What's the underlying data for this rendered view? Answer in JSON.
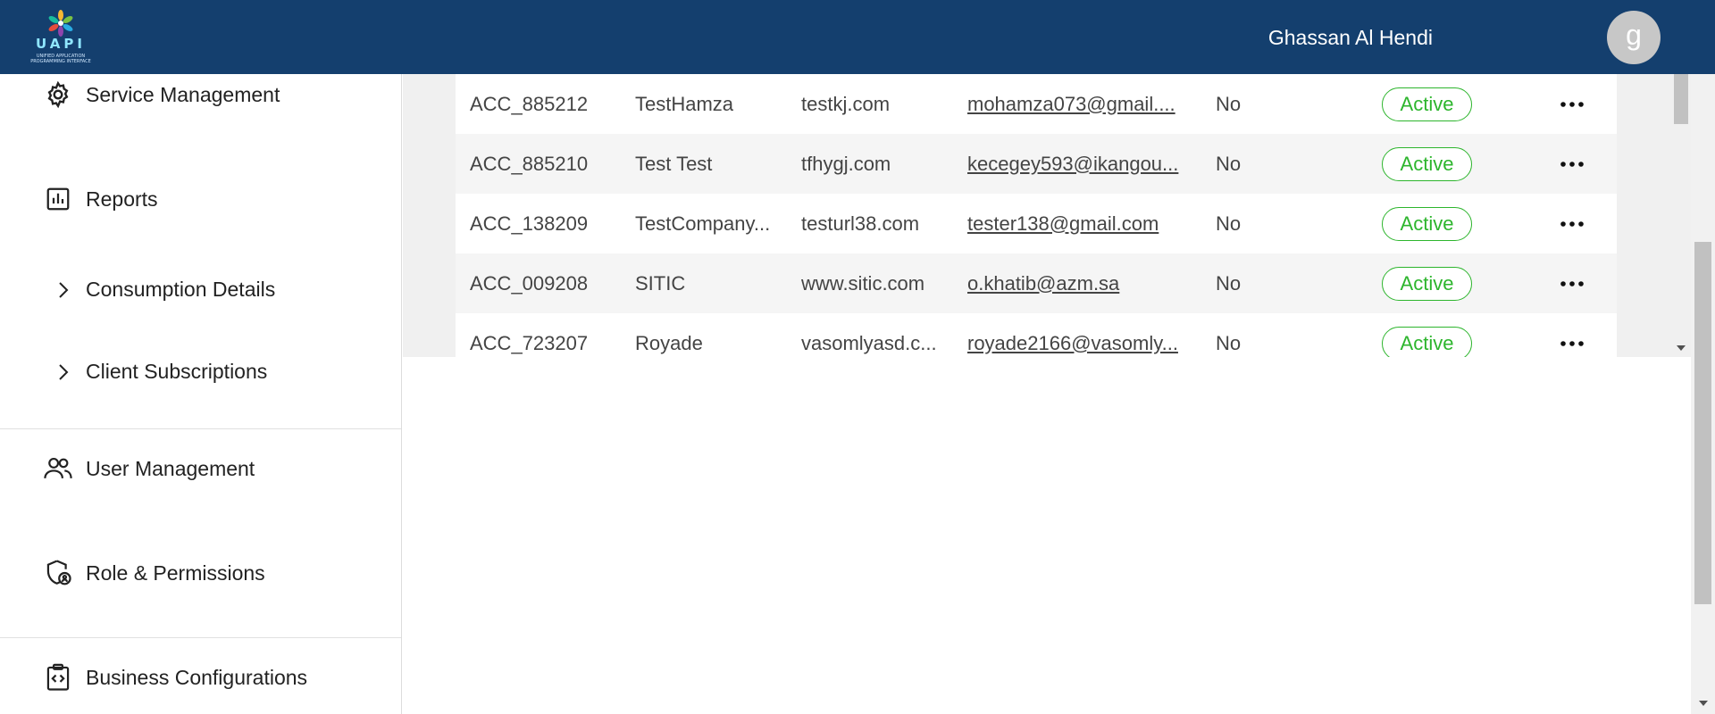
{
  "header": {
    "logo_text": "UAPI",
    "logo_subtitle": "UNIFIED APPLICATION PROGRAMMING INTERFACE",
    "user_name": "Ghassan Al Hendi",
    "avatar_initial": "g"
  },
  "sidebar": {
    "items": [
      {
        "label": "Service Management",
        "icon": "gear-icon"
      },
      {
        "label": "Reports",
        "icon": "bar-chart-icon"
      },
      {
        "label": "Consumption Details",
        "icon": "chevron-right-icon"
      },
      {
        "label": "Client Subscriptions",
        "icon": "chevron-right-icon"
      },
      {
        "label": "User Management",
        "icon": "users-icon"
      },
      {
        "label": "Role & Permissions",
        "icon": "shield-icon"
      },
      {
        "label": "Business Configurations",
        "icon": "code-clipboard-icon"
      }
    ]
  },
  "table": {
    "rows": [
      {
        "id": "ACC_885212",
        "name": "TestHamza",
        "url": "testkj.com",
        "email": "mohamza073@gmail....",
        "flag": "No",
        "status": "Active"
      },
      {
        "id": "ACC_885210",
        "name": "Test Test",
        "url": "tfhygj.com",
        "email": "kecegey593@ikangou...",
        "flag": "No",
        "status": "Active"
      },
      {
        "id": "ACC_138209",
        "name": "TestCompany...",
        "url": "testurl38.com",
        "email": "tester138@gmail.com",
        "flag": "No",
        "status": "Active"
      },
      {
        "id": "ACC_009208",
        "name": "SITIC",
        "url": "www.sitic.com",
        "email": "o.khatib@azm.sa",
        "flag": "No",
        "status": "Active"
      },
      {
        "id": "ACC_723207",
        "name": "Royade",
        "url": "vasomlyasd.c...",
        "email": "royade2166@vasomly...",
        "flag": "No",
        "status": "Active"
      }
    ]
  },
  "colors": {
    "header_bg": "#143f6e",
    "active_green": "#2db52d",
    "avatar_bg": "#c7c7c7"
  }
}
